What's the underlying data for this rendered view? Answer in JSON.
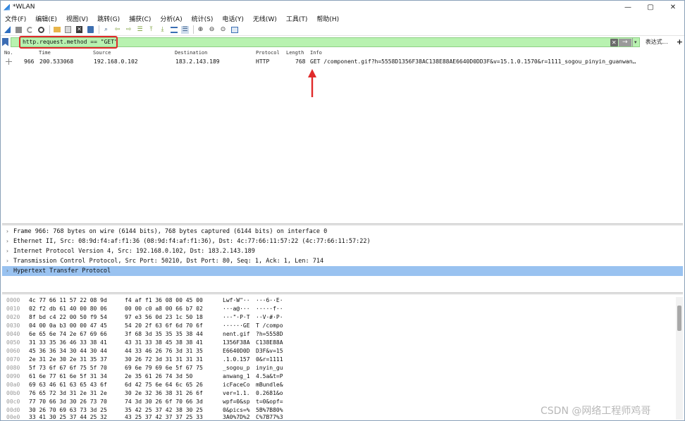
{
  "window": {
    "title": "*WLAN",
    "controls": [
      "—",
      "▢",
      "✕"
    ]
  },
  "menu": [
    "文件(F)",
    "编辑(E)",
    "视图(V)",
    "跳转(G)",
    "捕获(C)",
    "分析(A)",
    "统计(S)",
    "电话(Y)",
    "无线(W)",
    "工具(T)",
    "帮助(H)"
  ],
  "toolbar": {
    "icons": [
      "start-capture-icon",
      "stop-capture-icon",
      "restart-capture-icon",
      "capture-options-icon",
      "open-file-icon",
      "save-file-icon",
      "close-file-icon",
      "reload-file-icon",
      "find-packet-icon",
      "go-back-icon",
      "go-forward-icon",
      "go-to-packet-icon",
      "go-first-icon",
      "go-last-icon",
      "auto-scroll-icon",
      "colorize-icon",
      "zoom-in-icon",
      "zoom-out-icon",
      "zoom-normal-icon",
      "resize-columns-icon"
    ]
  },
  "filter": {
    "value": "http.request.method == \"GET\"",
    "clear_glyph": "✕",
    "apply_glyph": "→",
    "dropdown_glyph": "▾",
    "expression_label": "表达式…",
    "add_glyph": "+",
    "bg_color": "#b8f2b0",
    "highlight_color": "#e02a2a"
  },
  "packet_list": {
    "columns": [
      "No.",
      "Time",
      "Source",
      "Destination",
      "Protocol",
      "Length",
      "Info"
    ],
    "rows": [
      {
        "no": "966",
        "time": "200.533068",
        "source": "192.168.0.102",
        "destination": "183.2.143.189",
        "protocol": "HTTP",
        "length": "768",
        "info": "GET /component.gif?h=5558D1356F38AC138E88AE6640D0DD3F&v=15.1.0.1570&r=1111_sogou_pinyin_guanwan…"
      }
    ]
  },
  "details": [
    {
      "caret": "›",
      "text": "Frame 966: 768 bytes on wire (6144 bits), 768 bytes captured (6144 bits) on interface 0",
      "selected": false
    },
    {
      "caret": "›",
      "text": "Ethernet II, Src: 08:9d:f4:af:f1:36 (08:9d:f4:af:f1:36), Dst: 4c:77:66:11:57:22 (4c:77:66:11:57:22)",
      "selected": false
    },
    {
      "caret": "›",
      "text": "Internet Protocol Version 4, Src: 192.168.0.102, Dst: 183.2.143.189",
      "selected": false
    },
    {
      "caret": "›",
      "text": "Transmission Control Protocol, Src Port: 50210, Dst Port: 80, Seq: 1, Ack: 1, Len: 714",
      "selected": false
    },
    {
      "caret": "›",
      "text": "Hypertext Transfer Protocol",
      "selected": true
    }
  ],
  "bytes": [
    {
      "offset": "0000",
      "hex1": "4c 77 66 11 57 22 08 9d",
      "hex2": "f4 af f1 36 08 00 45 00",
      "ascii1": "Lwf·W\"··",
      "ascii2": "···6··E·"
    },
    {
      "offset": "0010",
      "hex1": "02 f2 db 61 40 00 80 06",
      "hex2": "00 00 c0 a8 00 66 b7 02",
      "ascii1": "···a@···",
      "ascii2": "·····f··"
    },
    {
      "offset": "0020",
      "hex1": "8f bd c4 22 00 50 f9 54",
      "hex2": "97 e3 56 0d 23 1c 50 18",
      "ascii1": "···\"·P·T",
      "ascii2": "··V·#·P·"
    },
    {
      "offset": "0030",
      "hex1": "04 00 0a b3 00 00 47 45",
      "hex2": "54 20 2f 63 6f 6d 70 6f",
      "ascii1": "······GE",
      "ascii2": "T /compo"
    },
    {
      "offset": "0040",
      "hex1": "6e 65 6e 74 2e 67 69 66",
      "hex2": "3f 68 3d 35 35 35 38 44",
      "ascii1": "nent.gif",
      "ascii2": "?h=5558D"
    },
    {
      "offset": "0050",
      "hex1": "31 33 35 36 46 33 38 41",
      "hex2": "43 31 33 38 45 38 38 41",
      "ascii1": "1356F38A",
      "ascii2": "C138E88A"
    },
    {
      "offset": "0060",
      "hex1": "45 36 36 34 30 44 30 44",
      "hex2": "44 33 46 26 76 3d 31 35",
      "ascii1": "E6640D0D",
      "ascii2": "D3F&v=15"
    },
    {
      "offset": "0070",
      "hex1": "2e 31 2e 30 2e 31 35 37",
      "hex2": "30 26 72 3d 31 31 31 31",
      "ascii1": ".1.0.157",
      "ascii2": "0&r=1111"
    },
    {
      "offset": "0080",
      "hex1": "5f 73 6f 67 6f 75 5f 70",
      "hex2": "69 6e 79 69 6e 5f 67 75",
      "ascii1": "_sogou_p",
      "ascii2": "inyin_gu"
    },
    {
      "offset": "0090",
      "hex1": "61 6e 77 61 6e 5f 31 34",
      "hex2": "2e 35 61 26 74 3d 50",
      "ascii1": "anwang_1",
      "ascii2": "4.5a&t=P"
    },
    {
      "offset": "00a0",
      "hex1": "69 63 46 61 63 65 43 6f",
      "hex2": "6d 42 75 6e 64 6c 65 26",
      "ascii1": "icFaceCo",
      "ascii2": "mBundle&"
    },
    {
      "offset": "00b0",
      "hex1": "76 65 72 3d 31 2e 31 2e",
      "hex2": "30 2e 32 36 38 31 26 6f",
      "ascii1": "ver=1.1.",
      "ascii2": "0.2681&o"
    },
    {
      "offset": "00c0",
      "hex1": "77 70 66 3d 30 26 73 70",
      "hex2": "74 3d 30 26 6f 70 66 3d",
      "ascii1": "wpf=0&sp",
      "ascii2": "t=0&opf="
    },
    {
      "offset": "00d0",
      "hex1": "30 26 70 69 63 73 3d 25",
      "hex2": "35 42 25 37 42 38 30 25",
      "ascii1": "0&pics=%",
      "ascii2": "5B%7B80%"
    },
    {
      "offset": "00e0",
      "hex1": "33 41 30 25 37 44 25 32",
      "hex2": "43 25 37 42 37 37 25 33",
      "ascii1": "3A0%7D%2",
      "ascii2": "C%7B77%3"
    }
  ],
  "watermark": "CSDN @网络工程师鸡哥"
}
